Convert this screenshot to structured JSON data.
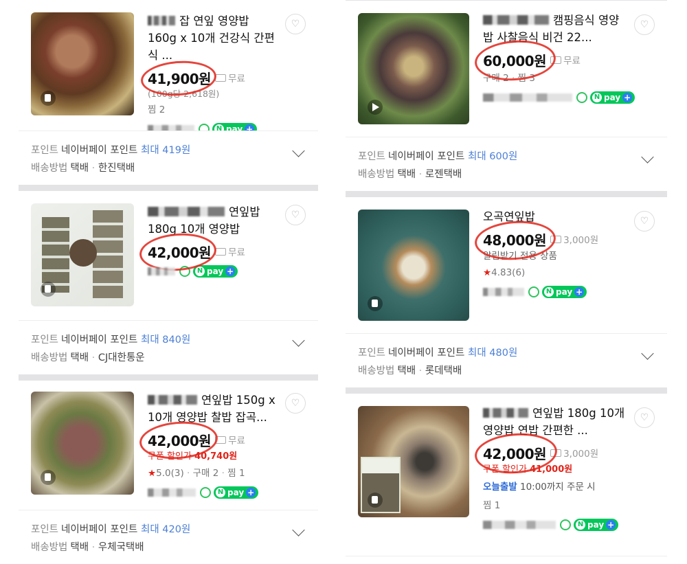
{
  "left_column": {
    "products": [
      {
        "title": "잡 연잎 영양밥 160g x 10개 건강식 간편식 ...",
        "price": "41,900원",
        "shipping": "무료",
        "unit_price": "(100g당 2,618원)",
        "zzim": "찜 2",
        "npay_label": "pay",
        "point_label": "포인트",
        "point_text": "네이버페이 포인트",
        "point_max": "최대 419원",
        "delivery_label": "배송방법",
        "delivery_text": "택배",
        "courier": "한진택배"
      },
      {
        "title": "연잎밥 180g 10개 영양밥",
        "price": "42,000원",
        "shipping": "무료",
        "npay_label": "pay",
        "point_label": "포인트",
        "point_text": "네이버페이 포인트",
        "point_max": "최대 840원",
        "delivery_label": "배송방법",
        "delivery_text": "택배",
        "courier": "CJ대한통운"
      },
      {
        "title": "연잎밥 150g x 10개 영양밥 찰밥 잡곡...",
        "price": "42,000원",
        "shipping": "무료",
        "coupon_label": "쿠폰 할인가",
        "coupon_price": "40,740원",
        "rating": "5.0",
        "review_count": "(3)",
        "sales": "구매 2",
        "zzim": "찜 1",
        "npay_label": "pay",
        "point_label": "포인트",
        "point_text": "네이버페이 포인트",
        "point_max": "최대 420원",
        "delivery_label": "배송방법",
        "delivery_text": "택배",
        "courier": "우체국택배"
      }
    ]
  },
  "right_column": {
    "products": [
      {
        "title": "캠핑음식 영양밥 사찰음식 비건 22...",
        "price": "60,000원",
        "shipping": "무료",
        "sales": "구매 2",
        "zzim": "찜 3",
        "npay_label": "pay",
        "point_label": "포인트",
        "point_text": "네이버페이 포인트",
        "point_max": "최대 600원",
        "delivery_label": "배송방법",
        "delivery_text": "택배",
        "courier": "로젠택배"
      },
      {
        "title": "오곡연잎밥",
        "price": "48,000원",
        "shipping": "3,000원",
        "notice": "알림받기 전용 상품",
        "rating": "4.83",
        "review_count": "(6)",
        "npay_label": "pay",
        "point_label": "포인트",
        "point_text": "네이버페이 포인트",
        "point_max": "최대 480원",
        "delivery_label": "배송방법",
        "delivery_text": "택배",
        "courier": "롯데택배"
      },
      {
        "title": "연잎밥 180g 10개 영양밥 연밥 간편한 ...",
        "price": "42,000원",
        "shipping": "3,000원",
        "coupon_label": "쿠폰 할인가",
        "coupon_price": "41,000원",
        "today_label": "오늘출발",
        "today_text": "10:00까지 주문 시",
        "zzim": "찜 1",
        "npay_label": "pay"
      }
    ]
  }
}
